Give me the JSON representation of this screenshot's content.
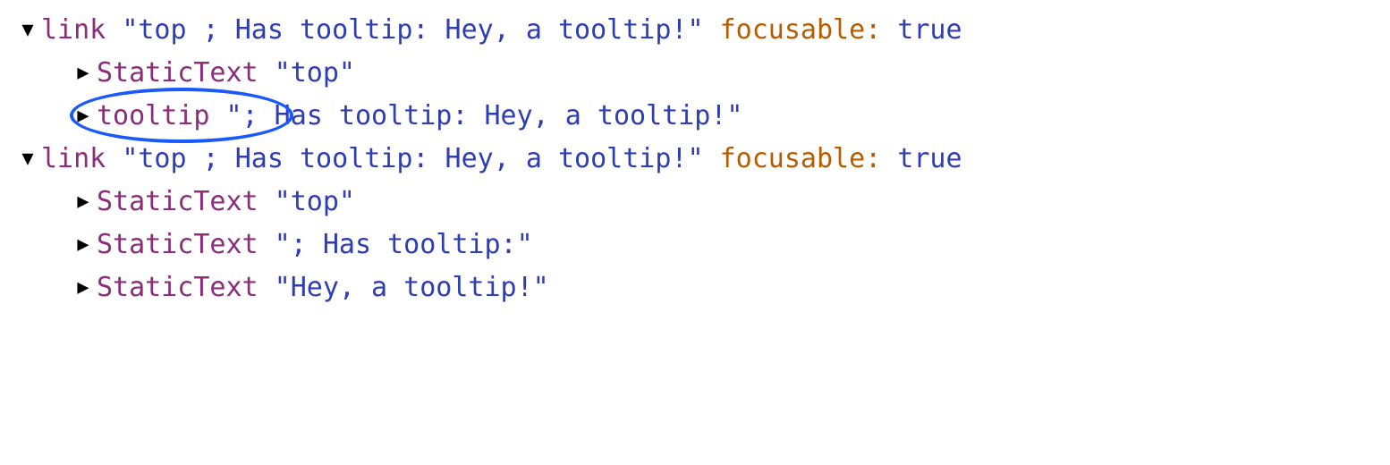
{
  "tree": [
    {
      "expanded": true,
      "role": "link",
      "name": "\"top ; Has tooltip: Hey, a tooltip!\"",
      "attr_key": "focusable",
      "attr_val": "true",
      "children": [
        {
          "expanded": false,
          "role": "StaticText",
          "name": "\"top\""
        },
        {
          "expanded": false,
          "role": "tooltip",
          "name": "\"; Has tooltip: Hey, a tooltip!\"",
          "circled": true
        }
      ]
    },
    {
      "expanded": true,
      "role": "link",
      "name": "\"top ; Has tooltip: Hey, a tooltip!\"",
      "attr_key": "focusable",
      "attr_val": "true",
      "children": [
        {
          "expanded": false,
          "role": "StaticText",
          "name": "\"top\""
        },
        {
          "expanded": false,
          "role": "StaticText",
          "name": "\"; Has tooltip:\""
        },
        {
          "expanded": false,
          "role": "StaticText",
          "name": "\"Hey, a tooltip!\""
        }
      ]
    }
  ],
  "glyphs": {
    "expanded": "▼",
    "collapsed": "▶"
  }
}
